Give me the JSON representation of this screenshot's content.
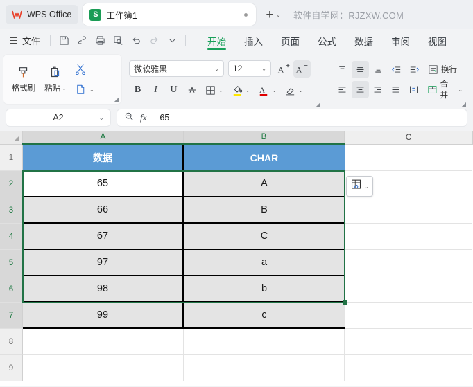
{
  "titlebar": {
    "brand": "WPS Office",
    "brand_logo_icon": "wps-logo-icon",
    "tab_label": "工作簿1",
    "tab_icon": "spreadsheet-s-icon",
    "new_tab_icon": "plus-icon",
    "new_tab_caret": "⌄",
    "watermark": "软件自学网：RJZXW.COM"
  },
  "menubar": {
    "file_label": "文件",
    "quick_icons": [
      "save-icon",
      "share-link-icon",
      "print-icon",
      "print-preview-icon",
      "undo-icon",
      "redo-icon",
      "customize-caret-icon"
    ],
    "tabs": [
      {
        "label": "开始",
        "active": true
      },
      {
        "label": "插入",
        "active": false
      },
      {
        "label": "页面",
        "active": false
      },
      {
        "label": "公式",
        "active": false
      },
      {
        "label": "数据",
        "active": false
      },
      {
        "label": "审阅",
        "active": false
      },
      {
        "label": "视图",
        "active": false
      }
    ]
  },
  "ribbon": {
    "clipboard": {
      "format_painter_label": "格式刷",
      "paste_label": "粘贴",
      "cut_icon": "scissors-icon",
      "copy_icon": "copy-icon"
    },
    "font": {
      "family_value": "微软雅黑",
      "size_value": "12",
      "grow_label": "A",
      "shrink_label": "A",
      "bold_label": "B",
      "italic_label": "I",
      "underline_label": "U",
      "strike_icon": "strikethrough-icon",
      "border_icon": "borders-icon",
      "fill_icon": "fill-color-icon",
      "fontcolor_icon": "font-color-icon",
      "clear_icon": "clear-format-icon",
      "fill_color": "#ffe600",
      "font_color": "#e00000"
    },
    "align": {
      "wrap_label": "换行",
      "merge_label": "合并",
      "top_icon": "align-top-icon",
      "middle_icon": "align-middle-icon",
      "bottom_icon": "align-bottom-icon",
      "dec_indent_icon": "decrease-indent-icon",
      "inc_indent_icon": "increase-indent-icon",
      "left_icon": "align-left-icon",
      "center_icon": "align-center-icon",
      "right_icon": "align-right-icon",
      "justify_icon": "align-justify-icon",
      "distribute_icon": "distribute-icon"
    }
  },
  "formulabar": {
    "namebox_value": "A2",
    "namebox_caret": "⌄",
    "zoom_icon": "zoom-formula-icon",
    "fx_label": "fx",
    "formula_value": "65"
  },
  "sheet": {
    "columns": [
      {
        "label": "A",
        "selected": true
      },
      {
        "label": "B",
        "selected": true
      },
      {
        "label": "C",
        "selected": false
      }
    ],
    "rows": [
      {
        "num": "1",
        "selected": false,
        "type": "header",
        "a": "数据",
        "b": "CHAR",
        "c": ""
      },
      {
        "num": "2",
        "selected": true,
        "type": "data",
        "active": true,
        "a": "65",
        "b": "A",
        "c": ""
      },
      {
        "num": "3",
        "selected": true,
        "type": "data",
        "a": "66",
        "b": "B",
        "c": ""
      },
      {
        "num": "4",
        "selected": true,
        "type": "data",
        "a": "67",
        "b": "C",
        "c": ""
      },
      {
        "num": "5",
        "selected": true,
        "type": "data",
        "a": "97",
        "b": "a",
        "c": ""
      },
      {
        "num": "6",
        "selected": true,
        "type": "data",
        "a": "98",
        "b": "b",
        "c": ""
      },
      {
        "num": "7",
        "selected": true,
        "type": "data",
        "a": "99",
        "b": "c",
        "c": ""
      },
      {
        "num": "8",
        "selected": false,
        "type": "empty",
        "a": "",
        "b": "",
        "c": ""
      },
      {
        "num": "9",
        "selected": false,
        "type": "empty",
        "a": "",
        "b": "",
        "c": ""
      }
    ],
    "header_fill": "#5b9bd5",
    "selection_color": "#217346",
    "data_fill": "#e4e4e4",
    "paste_options_icon": "paste-options-icon",
    "paste_options_caret": "⌄"
  }
}
